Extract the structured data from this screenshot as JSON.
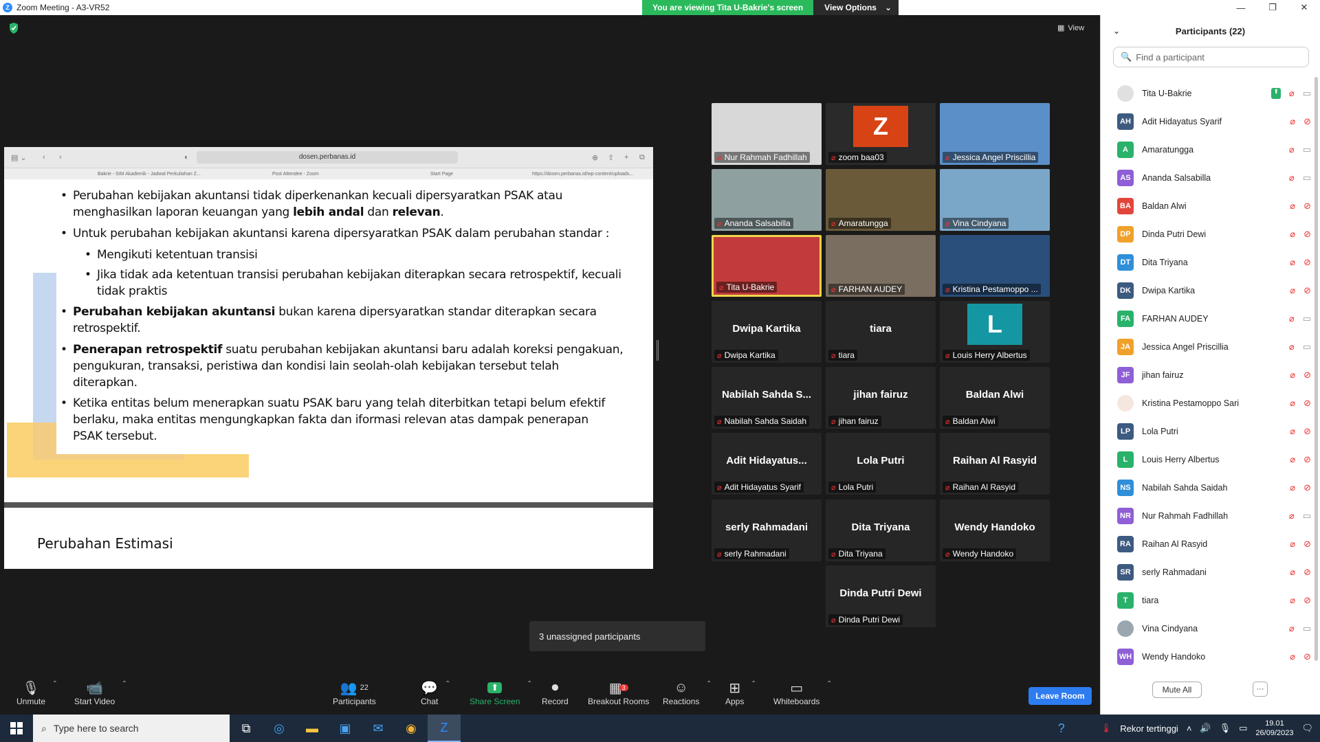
{
  "window": {
    "title": "Zoom Meeting - A3-VR52",
    "controls": [
      "—",
      "❐",
      "✕"
    ]
  },
  "banner": {
    "viewing": "You are viewing Tita U-Bakrie's screen",
    "view_options": "View Options"
  },
  "view_button": "View",
  "browser": {
    "url": "dosen.perbanas.id",
    "tabs": [
      "Bakrie - SIM Akademik - Jadwal Perkuliahan Z...",
      "Post Attendee - Zoom",
      "Start Page",
      "https://dosen.perbanas.id/wp-content/uploads..."
    ]
  },
  "slide": {
    "b1_a": "Perubahan kebijakan akuntansi tidak diperkenankan kecuali dipersyaratkan PSAK atau",
    "b1_b_pre": "menghasilkan laporan keuangan yang ",
    "b1_b_bold1": "lebih andal",
    "b1_b_mid": " dan ",
    "b1_b_bold2": "relevan",
    "b1_b_end": ".",
    "b2": "Untuk perubahan kebijakan akuntansi karena dipersyaratkan PSAK dalam perubahan standar :",
    "b2_sub1": "Mengikuti ketentuan transisi",
    "b2_sub2_a": "Jika tidak ada ketentuan transisi perubahan kebijakan diterapkan secara retrospektif, kecuali",
    "b2_sub2_b": "tidak praktis",
    "b3_bold": "Perubahan kebijakan akuntansi",
    "b3_a": " bukan karena dipersyaratkan standar diterapkan secara",
    "b3_b": "retrospektif.",
    "b4_bold": "Penerapan retrospektif",
    "b4_a": " suatu perubahan kebijakan akuntansi baru adalah koreksi pengakuan,",
    "b4_b": "pengukuran, transaksi, peristiwa dan kondisi lain seolah-olah kebijakan tersebut telah",
    "b4_c": "diterapkan.",
    "b5_a": "Ketika entitas belum menerapkan suatu PSAK baru yang telah diterbitkan tetapi belum efektif",
    "b5_b": "berlaku, maka entitas mengungkapkan fakta dan iformasi relevan atas dampak penerapan",
    "b5_c": "PSAK tersebut.",
    "next_title": "Perubahan Estimasi"
  },
  "tiles": [
    {
      "label": "Nur Rahmah Fadhillah",
      "center": "",
      "bg": "#d8d8d8"
    },
    {
      "label": "zoom baa03",
      "center": "",
      "bg": "#2a2a2a",
      "letter": "Z",
      "letter_bg": "#d84315"
    },
    {
      "label": "Jessica Angel Priscillia",
      "center": "",
      "bg": "#5b8fc8"
    },
    {
      "label": "Ananda Salsabilla",
      "center": "",
      "bg": "#8fa0a0"
    },
    {
      "label": "Amaratungga",
      "center": "",
      "bg": "#6a5a3a"
    },
    {
      "label": "Vina Cindyana",
      "center": "",
      "bg": "#7aa6c8"
    },
    {
      "label": "Tita U-Bakrie",
      "center": "",
      "bg": "#c23b3b"
    },
    {
      "label": "FARHAN AUDEY",
      "center": "",
      "bg": "#7a6e60"
    },
    {
      "label": "Kristina Pestamoppo ...",
      "center": "",
      "bg": "#2a4f7a"
    },
    {
      "label": "Dwipa Kartika",
      "center": "Dwipa Kartika",
      "bg": "#262626"
    },
    {
      "label": "tiara",
      "center": "tiara",
      "bg": "#262626"
    },
    {
      "label": "Louis Herry Albertus",
      "center": "",
      "bg": "#262626",
      "letter": "L",
      "letter_bg": "#1597a3"
    },
    {
      "label": "Nabilah Sahda Saidah",
      "center": "Nabilah  Sahda  S...",
      "bg": "#262626"
    },
    {
      "label": "jihan fairuz",
      "center": "jihan fairuz",
      "bg": "#262626"
    },
    {
      "label": "Baldan Alwi",
      "center": "Baldan Alwi",
      "bg": "#262626"
    },
    {
      "label": "Adit Hidayatus Syarif",
      "center": "Adit  Hidayatus...",
      "bg": "#262626"
    },
    {
      "label": "Lola Putri",
      "center": "Lola Putri",
      "bg": "#262626"
    },
    {
      "label": "Raihan Al Rasyid",
      "center": "Raihan Al Rasyid",
      "bg": "#262626"
    },
    {
      "label": "serly Rahmadani",
      "center": "serly Rahmadani",
      "bg": "#262626"
    },
    {
      "label": "Dita Triyana",
      "center": "Dita Triyana",
      "bg": "#262626"
    },
    {
      "label": "Wendy Handoko",
      "center": "Wendy Handoko",
      "bg": "#262626"
    },
    {
      "label": "Dinda Putri Dewi",
      "center": "Dinda Putri Dewi",
      "bg": "#262626"
    }
  ],
  "unassigned": "3 unassigned participants",
  "toolbar": {
    "unmute": "Unmute",
    "start_video": "Start Video",
    "participants": "Participants",
    "participants_count": "22",
    "chat": "Chat",
    "share_screen": "Share Screen",
    "record": "Record",
    "breakout_rooms": "Breakout Rooms",
    "breakout_badge": "3",
    "reactions": "Reactions",
    "apps": "Apps",
    "whiteboards": "Whiteboards",
    "leave_room": "Leave Room"
  },
  "panel": {
    "title": "Participants (22)",
    "search_placeholder": "Find a participant",
    "mute_all": "Mute All",
    "more": "···",
    "participants": [
      {
        "initials": "",
        "name": "Tita U-Bakrie",
        "color": "#e0e0e0",
        "video": "on",
        "share": true
      },
      {
        "initials": "AH",
        "name": "Adit Hidayatus Syarif",
        "color": "#3d5a80",
        "video": "off"
      },
      {
        "initials": "A",
        "name": "Amaratungga",
        "color": "#2ab26a",
        "video": "on"
      },
      {
        "initials": "AS",
        "name": "Ananda Salsabilla",
        "color": "#8e5fd6",
        "video": "on"
      },
      {
        "initials": "BA",
        "name": "Baldan Alwi",
        "color": "#e2463b",
        "video": "off"
      },
      {
        "initials": "DP",
        "name": "Dinda Putri Dewi",
        "color": "#f0a12b",
        "video": "off"
      },
      {
        "initials": "DT",
        "name": "Dita Triyana",
        "color": "#2f8fd8",
        "video": "off"
      },
      {
        "initials": "DK",
        "name": "Dwipa Kartika",
        "color": "#3d5a80",
        "video": "off"
      },
      {
        "initials": "FA",
        "name": "FARHAN AUDEY",
        "color": "#2ab26a",
        "video": "on"
      },
      {
        "initials": "JA",
        "name": "Jessica Angel Priscillia",
        "color": "#f0a12b",
        "video": "on"
      },
      {
        "initials": "JF",
        "name": "jihan fairuz",
        "color": "#8e5fd6",
        "video": "off"
      },
      {
        "initials": "",
        "name": "Kristina Pestamoppo Sari",
        "color": "#f5e6e0",
        "video": "off"
      },
      {
        "initials": "LP",
        "name": "Lola Putri",
        "color": "#3d5a80",
        "video": "off"
      },
      {
        "initials": "L",
        "name": "Louis Herry Albertus",
        "color": "#2ab26a",
        "video": "off"
      },
      {
        "initials": "NS",
        "name": "Nabilah Sahda Saidah",
        "color": "#2f8fd8",
        "video": "off"
      },
      {
        "initials": "NR",
        "name": "Nur Rahmah Fadhillah",
        "color": "#8e5fd6",
        "video": "on"
      },
      {
        "initials": "RA",
        "name": "Raihan Al Rasyid",
        "color": "#3d5a80",
        "video": "off"
      },
      {
        "initials": "SR",
        "name": "serly Rahmadani",
        "color": "#3d5a80",
        "video": "off"
      },
      {
        "initials": "T",
        "name": "tiara",
        "color": "#2ab26a",
        "video": "off"
      },
      {
        "initials": "",
        "name": "Vina Cindyana",
        "color": "#9aa7b0",
        "video": "on"
      },
      {
        "initials": "WH",
        "name": "Wendy Handoko",
        "color": "#8e5fd6",
        "video": "off"
      }
    ]
  },
  "taskbar": {
    "search_placeholder": "Type here to search",
    "weather": "Rekor tertinggi",
    "time": "19.01",
    "date": "26/09/2023"
  }
}
